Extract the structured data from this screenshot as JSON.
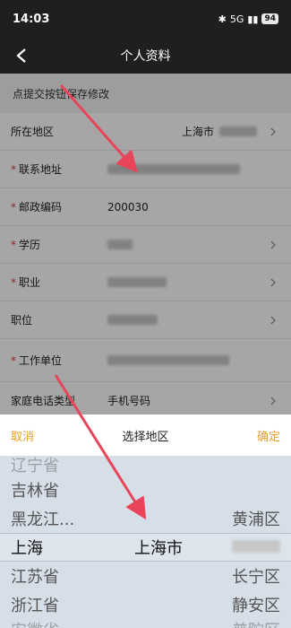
{
  "status": {
    "time": "14:03",
    "signal": "5G",
    "battery": "94"
  },
  "nav": {
    "title": "个人资料"
  },
  "hint": "点提交按钮保存修改",
  "form": {
    "region_label": "所在地区",
    "region_value": "上海市",
    "address_label": "联系地址",
    "postcode_label": "邮政编码",
    "postcode_value": "200030",
    "education_label": "学历",
    "occupation_label": "职业",
    "position_label": "职位",
    "company_label": "工作单位",
    "phone_type_label": "家庭电话类型",
    "phone_type_value": "手机号码"
  },
  "picker": {
    "cancel": "取消",
    "title": "选择地区",
    "ok": "确定",
    "provinces": [
      "辽宁省",
      "吉林省",
      "黑龙江...",
      "上海",
      "江苏省",
      "浙江省",
      "安徽省"
    ],
    "city": "上海市",
    "districts": [
      "黄浦区",
      "长宁区",
      "静安区",
      "普陀区"
    ]
  },
  "colors": {
    "accent": "#e5a026",
    "required": "#e23a3a",
    "arrow": "#e8455a"
  }
}
